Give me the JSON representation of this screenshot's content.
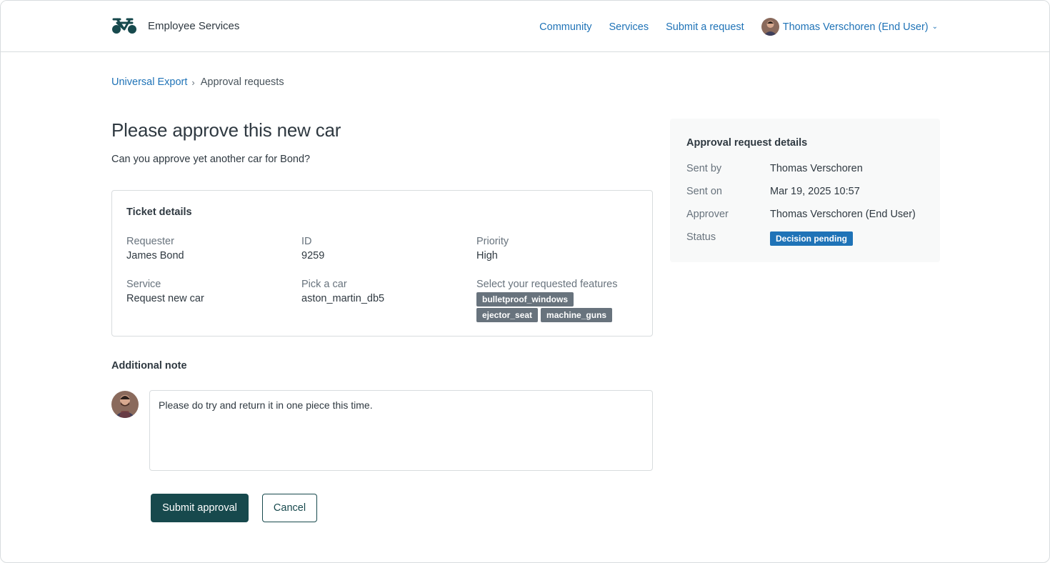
{
  "header": {
    "brand_name": "Employee Services",
    "nav": [
      "Community",
      "Services",
      "Submit a request"
    ],
    "user_name": "Thomas Verschoren (End User)"
  },
  "breadcrumb": {
    "parent": "Universal Export",
    "current": "Approval requests"
  },
  "main": {
    "title": "Please approve this new car",
    "description": "Can you approve yet another car for Bond?",
    "ticket": {
      "heading": "Ticket details",
      "requester_label": "Requester",
      "requester": "James Bond",
      "id_label": "ID",
      "id": "9259",
      "priority_label": "Priority",
      "priority": "High",
      "service_label": "Service",
      "service": "Request new car",
      "car_label": "Pick a car",
      "car": "aston_martin_db5",
      "features_label": "Select your requested features",
      "features": [
        "bulletproof_windows",
        "ejector_seat",
        "machine_guns"
      ]
    },
    "note_heading": "Additional note",
    "note_value": "Please do try and return it in one piece this time.",
    "submit_label": "Submit approval",
    "cancel_label": "Cancel"
  },
  "sidebar": {
    "heading": "Approval request details",
    "sent_by_label": "Sent by",
    "sent_by": "Thomas Verschoren",
    "sent_on_label": "Sent on",
    "sent_on": "Mar 19, 2025 10:57",
    "approver_label": "Approver",
    "approver": "Thomas Verschoren (End User)",
    "status_label": "Status",
    "status": "Decision pending"
  },
  "colors": {
    "link": "#1f73b7",
    "primary_button": "#17494d",
    "status_badge": "#1f73b7",
    "tag": "#68737d"
  }
}
